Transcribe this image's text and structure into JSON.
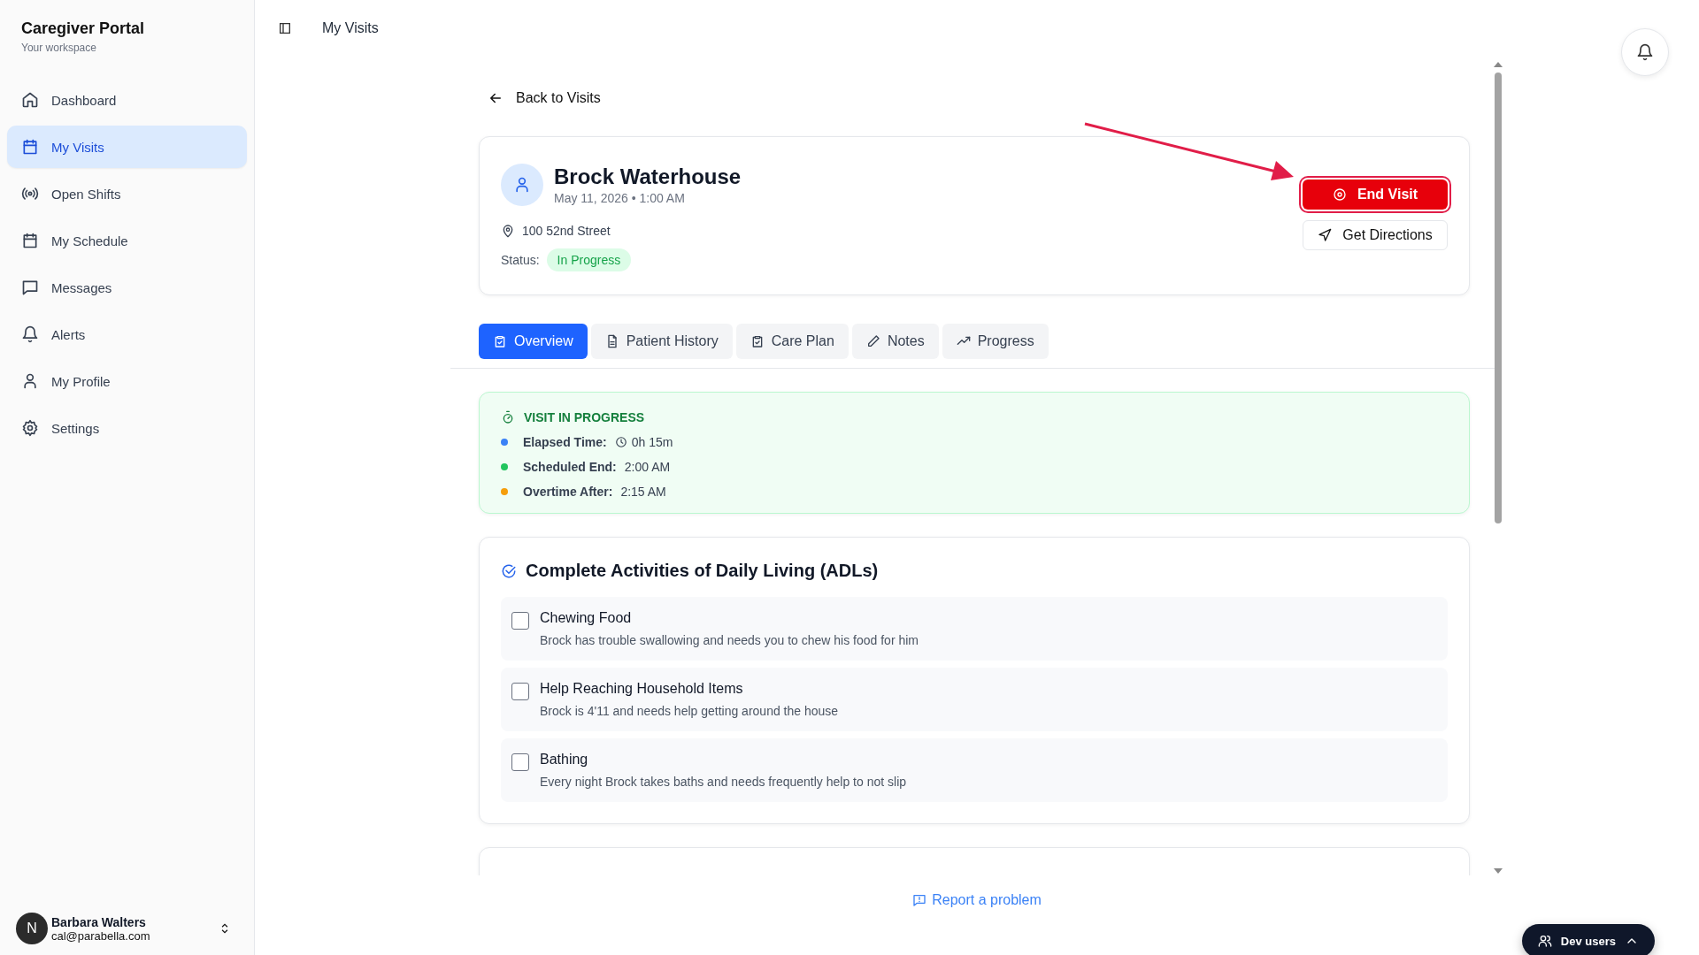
{
  "app": {
    "title": "Caregiver Portal",
    "subtitle": "Your workspace"
  },
  "nav": [
    {
      "label": "Dashboard",
      "selected": false
    },
    {
      "label": "My Visits",
      "selected": true
    },
    {
      "label": "Open Shifts",
      "selected": false
    },
    {
      "label": "My Schedule",
      "selected": false
    },
    {
      "label": "Messages",
      "selected": false
    },
    {
      "label": "Alerts",
      "selected": false
    },
    {
      "label": "My Profile",
      "selected": false
    },
    {
      "label": "Settings",
      "selected": false
    }
  ],
  "user": {
    "initial": "N",
    "name": "Barbara Walters",
    "email": "cal@parabella.com"
  },
  "header": {
    "title": "My Visits"
  },
  "back": "Back to Visits",
  "visit": {
    "patient": "Brock Waterhouse",
    "datetime": "May 11, 2026 • 1:00 AM",
    "address": "100 52nd Street",
    "status_label": "Status:",
    "status": "In Progress",
    "actions": [
      {
        "label": "End Visit",
        "kind": "danger",
        "highlighted": true
      },
      {
        "label": "Get Directions",
        "kind": "outline",
        "highlighted": false
      }
    ]
  },
  "tabs": [
    {
      "label": "Overview",
      "selected": true
    },
    {
      "label": "Patient History",
      "selected": false
    },
    {
      "label": "Care Plan",
      "selected": false
    },
    {
      "label": "Notes",
      "selected": false
    },
    {
      "label": "Progress",
      "selected": false
    }
  ],
  "progress": {
    "title": "VISIT IN PROGRESS",
    "items": [
      {
        "label": "Elapsed Time:",
        "value": "0h 15m",
        "color": "#3b82f6",
        "kind": "timer"
      },
      {
        "label": "Scheduled End:",
        "value": "2:00 AM",
        "color": "#22c55e",
        "kind": "text"
      },
      {
        "label": "Overtime After:",
        "value": "2:15 AM",
        "color": "#f59e0b",
        "kind": "text"
      }
    ]
  },
  "adl": {
    "title": "Complete Activities of Daily Living (ADLs)",
    "items": [
      {
        "name": "Chewing Food",
        "description": "Brock has trouble swallowing and needs you to chew his food for him",
        "checked": false
      },
      {
        "name": "Help Reaching Household Items",
        "description": "Brock is 4'11 and needs help getting around the house",
        "checked": false
      },
      {
        "name": "Bathing",
        "description": "Every night Brock takes baths and needs frequently help to not slip",
        "checked": false
      }
    ]
  },
  "footer": {
    "report": "Report a problem"
  },
  "dev": {
    "label": "Dev users"
  }
}
